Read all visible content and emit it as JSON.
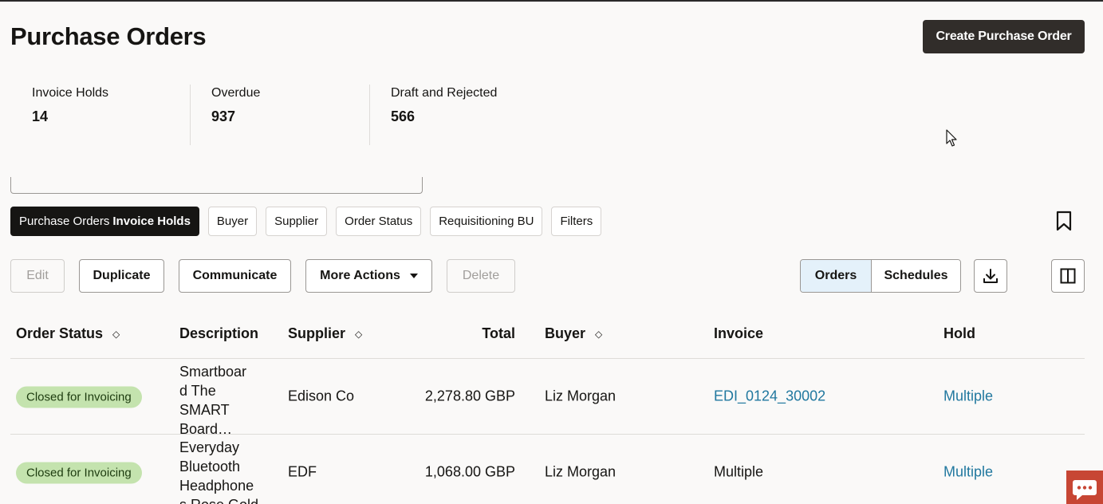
{
  "header": {
    "title": "Purchase Orders",
    "create_button": "Create Purchase Order"
  },
  "metrics": [
    {
      "label": "Invoice Holds",
      "value": "14"
    },
    {
      "label": "Overdue",
      "value": "937"
    },
    {
      "label": "Draft and Rejected",
      "value": "566"
    }
  ],
  "filters": {
    "active_prefix": "Purchase Orders",
    "active_bold": "Invoice Holds",
    "chips": [
      "Buyer",
      "Supplier",
      "Order Status",
      "Requisitioning BU",
      "Filters"
    ]
  },
  "toolbar": {
    "edit": "Edit",
    "duplicate": "Duplicate",
    "communicate": "Communicate",
    "more_actions": "More Actions",
    "delete": "Delete",
    "view_orders": "Orders",
    "view_schedules": "Schedules"
  },
  "table": {
    "columns": {
      "order_status": "Order Status",
      "description": "Description",
      "supplier": "Supplier",
      "total": "Total",
      "buyer": "Buyer",
      "invoice": "Invoice",
      "hold": "Hold"
    },
    "rows": [
      {
        "status": "Closed for Invoicing",
        "description": [
          "Smartboar",
          "d The",
          "SMART",
          "Board…"
        ],
        "supplier": "Edison Co",
        "total": "2,278.80 GBP",
        "buyer": "Liz Morgan",
        "invoice": "EDI_0124_30002",
        "hold": "Multiple"
      },
      {
        "status": "Closed for Invoicing",
        "description": [
          "Everyday",
          "Bluetooth",
          "Headphone",
          "s Rose Gold"
        ],
        "supplier": "EDF",
        "total": "1,068.00 GBP",
        "buyer": "Liz Morgan",
        "invoice": "Multiple",
        "hold": "Multiple"
      }
    ]
  },
  "colors": {
    "primary_button": "#312d2a",
    "status_badge": "#c4e3ae",
    "link": "#21789f",
    "segment_active": "#e4f1fa",
    "chat_button": "#c74634"
  }
}
